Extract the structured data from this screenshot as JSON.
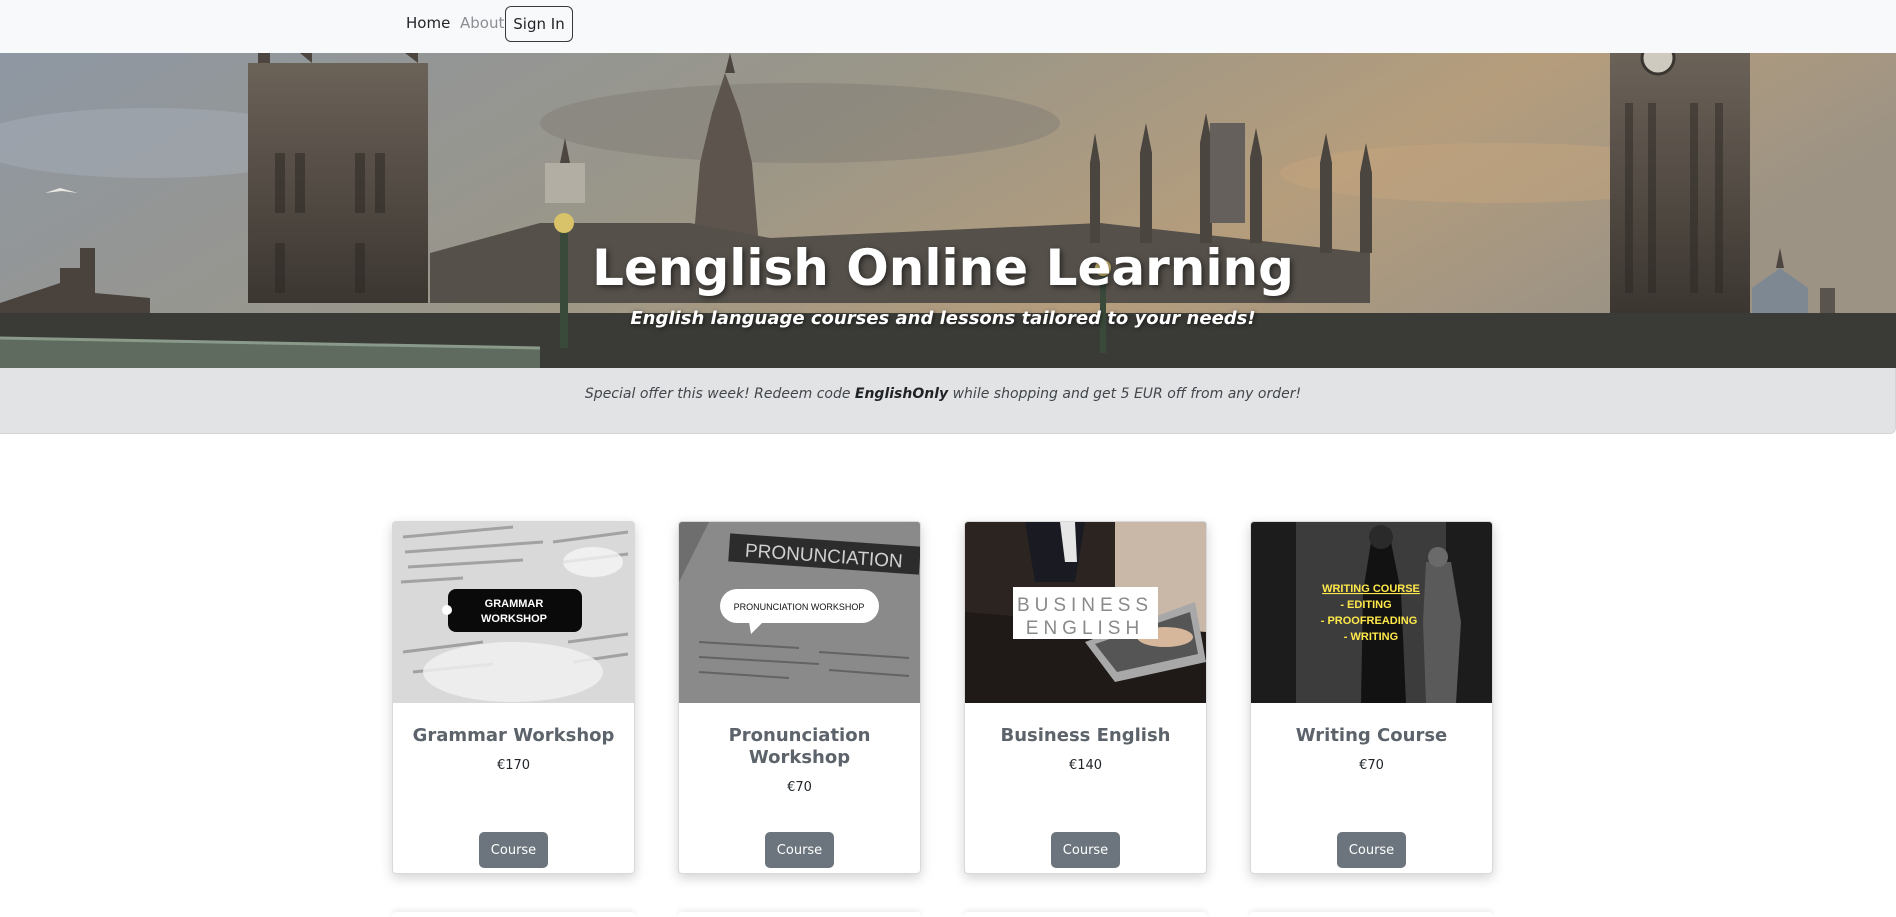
{
  "nav": {
    "home_label": "Home",
    "about_label": "About",
    "signin_label": "Sign In"
  },
  "hero": {
    "title": "Lenglish Online Learning",
    "subtitle": "English language courses and lessons tailored to your needs!"
  },
  "offer": {
    "text_before": "Special offer this week! Redeem code ",
    "code": "EnglishOnly",
    "text_after": " while shopping and get 5 EUR off from any order!"
  },
  "cards": [
    {
      "title": "Grammar Workshop",
      "price": "€170",
      "button_label": "Course",
      "image_label_line1": "GRAMMAR",
      "image_label_line2": "WORKSHOP"
    },
    {
      "title": "Pronunciation Workshop",
      "price": "€70",
      "button_label": "Course",
      "image_banner": "PRONUNCIATION",
      "image_bubble": "PRONUNCIATION WORKSHOP"
    },
    {
      "title": "Business English",
      "price": "€140",
      "button_label": "Course",
      "image_label_line1": "BUSINESS",
      "image_label_line2": "ENGLISH"
    },
    {
      "title": "Writing Course",
      "price": "€70",
      "button_label": "Course",
      "image_lines": [
        "WRITING COURSE",
        "- EDITING",
        "- PROOFREADING",
        "- WRITING"
      ]
    }
  ],
  "colors": {
    "navbar_bg": "#f8f9fa",
    "offer_bg": "#e2e3e5",
    "course_button_bg": "#6c757d",
    "card_title": "#5c636a",
    "writing_text": "#ffe84a"
  }
}
